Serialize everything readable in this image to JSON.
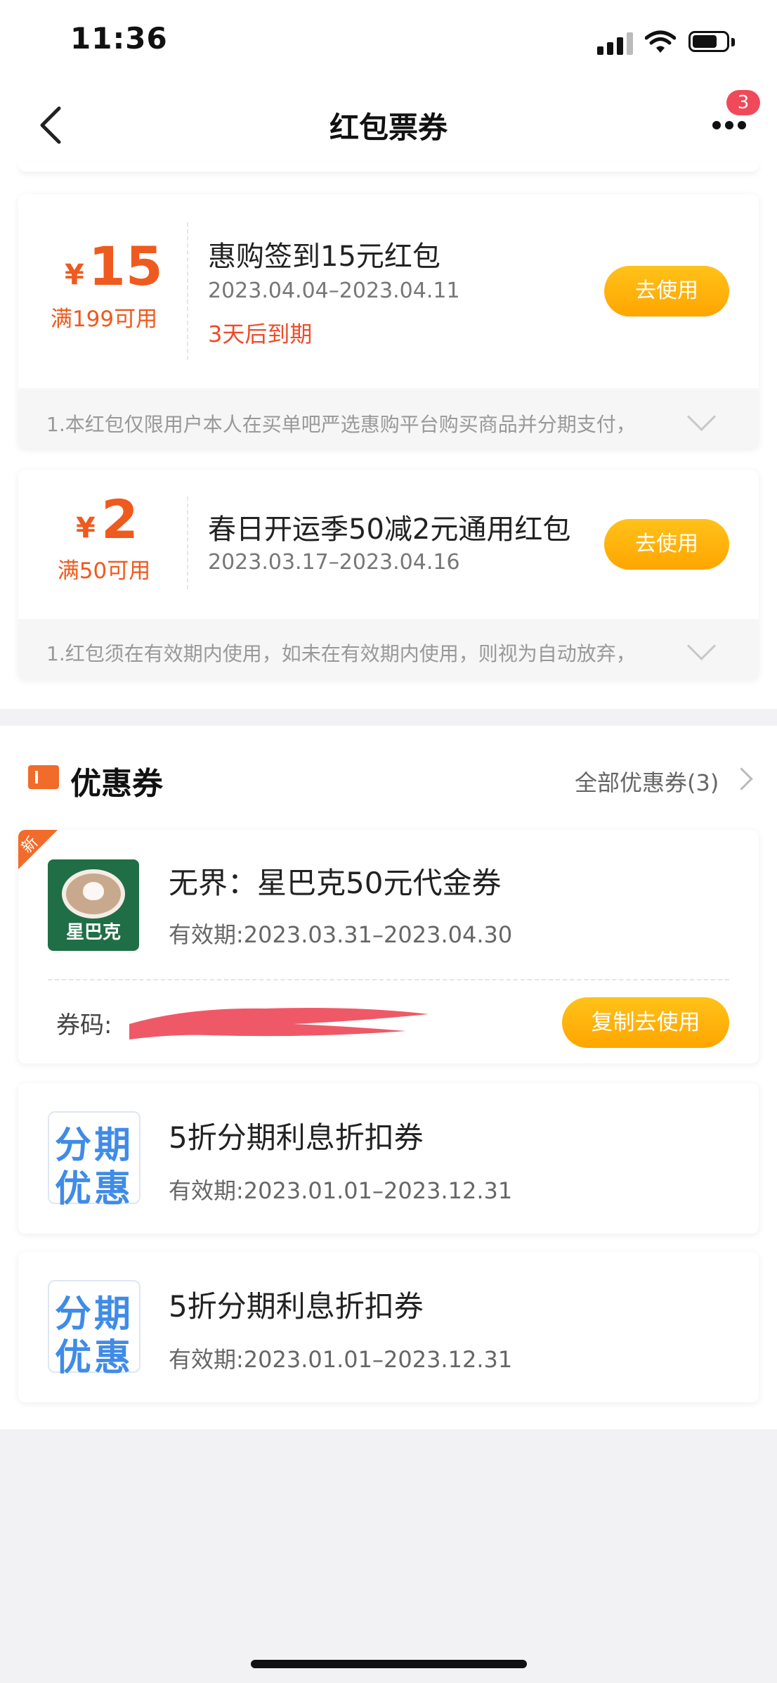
{
  "status_bar": {
    "time": "11:36"
  },
  "nav": {
    "title": "红包票券",
    "badge": "3"
  },
  "red_packets": [
    {
      "currency": "¥",
      "amount": "15",
      "condition": "满199可用",
      "title": "惠购签到15元红包",
      "date": "2023.04.04–2023.04.11",
      "expiry": "3天后到期",
      "button": "去使用",
      "note": "1.本红包仅限用户本人在买单吧严选惠购平台购买商品并分期支付，"
    },
    {
      "currency": "¥",
      "amount": "2",
      "condition": "满50可用",
      "title": "春日开运季50减2元通用红包",
      "date": "2023.03.17–2023.04.16",
      "button": "去使用",
      "note": "1.红包须在有效期内使用，如未在有效期内使用，则视为自动放弃，"
    }
  ],
  "coupons_section": {
    "title": "优惠券",
    "all_link": "全部优惠券(3)",
    "coupons": [
      {
        "tag": "新",
        "logo_label": "星巴克",
        "title": "无界：星巴克50元代金券",
        "validity": "有效期:2023.03.31–2023.04.30",
        "code_label": "券码:",
        "button": "复制去使用"
      },
      {
        "logo_line1": "分期",
        "logo_line2": "优惠",
        "title": "5折分期利息折扣券",
        "validity": "有效期:2023.01.01–2023.12.31"
      },
      {
        "logo_line1": "分期",
        "logo_line2": "优惠",
        "title": "5折分期利息折扣券",
        "validity": "有效期:2023.01.01–2023.12.31"
      }
    ]
  },
  "colors": {
    "accent_orange": "#ef5a1e",
    "button_yellow": "#ffaf0f",
    "badge_red": "#f04a5a",
    "ticket_blue": "#3f8be8",
    "starbucks_green": "#1f6e46"
  }
}
